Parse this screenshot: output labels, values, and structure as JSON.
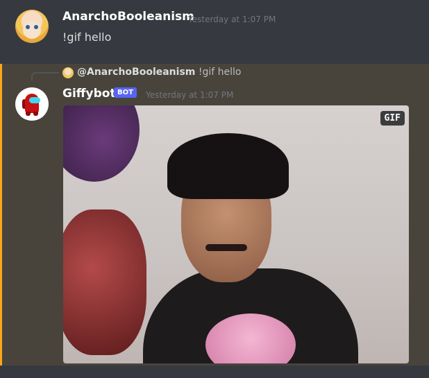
{
  "message1": {
    "username": "AnarchoBooleanism",
    "timestamp": "Yesterday at 1:07 PM",
    "content": "!gif hello"
  },
  "message2": {
    "reply": {
      "mention": "@AnarchoBooleanism",
      "content": "!gif hello"
    },
    "username": "Giffybot",
    "badge": "BOT",
    "timestamp": "Yesterday at 1:07 PM",
    "gif_badge": "GIF"
  },
  "colors": {
    "background": "#36393f",
    "mention_highlight": "#48443c",
    "mention_bar": "#faa81a",
    "bot_badge": "#5865f2"
  },
  "icons": [
    "user-avatar",
    "crewmate-avatar"
  ]
}
